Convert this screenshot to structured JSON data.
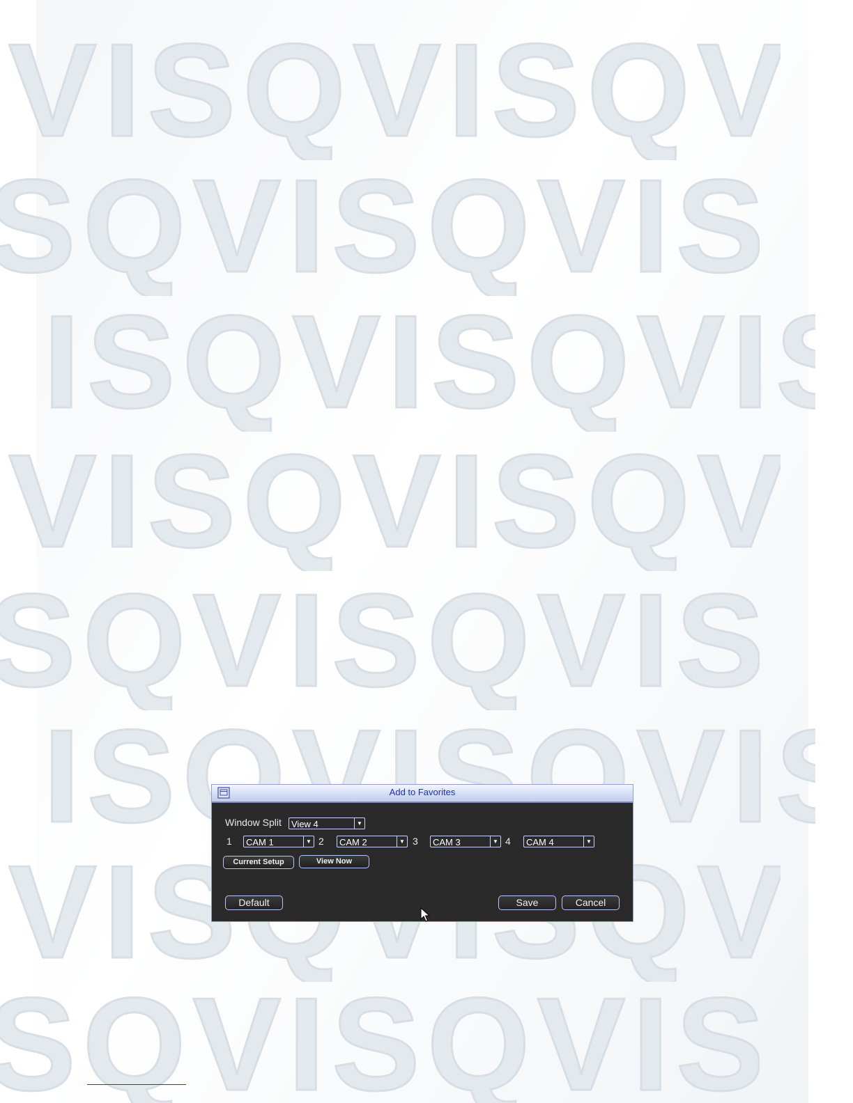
{
  "watermark": {
    "text_rows": [
      "VISQVISQVIS",
      "SQVISQVISQV",
      "ISQVISQVISQ",
      "VISQVISQVIS",
      "SQVISQVISQV",
      "ISQVISQVISQ",
      "VISQVISQVIS",
      "SQVISQVISQV"
    ]
  },
  "dialog": {
    "title": "Add to Favorites",
    "icon": "window-icon",
    "window_split": {
      "label": "Window Split",
      "value": "View 4"
    },
    "cameras": [
      {
        "index": "1",
        "value": "CAM 1"
      },
      {
        "index": "2",
        "value": "CAM 2"
      },
      {
        "index": "3",
        "value": "CAM 3"
      },
      {
        "index": "4",
        "value": "CAM 4"
      }
    ],
    "buttons": {
      "current_setup": "Current Setup",
      "view_now": "View Now",
      "default": "Default",
      "save": "Save",
      "cancel": "Cancel"
    }
  },
  "colors": {
    "title_text": "#1a2fc6",
    "dialog_bg": "#2a2a2a",
    "control_border": "#c8d2ff"
  }
}
